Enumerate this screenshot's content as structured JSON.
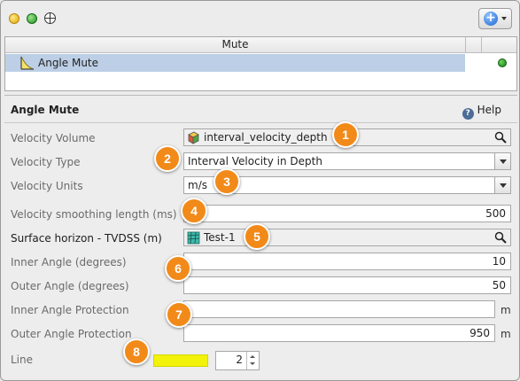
{
  "toolbar": {
    "window_controls": [
      "yellow",
      "green"
    ],
    "icons": [
      "grid-icon",
      "add-icon"
    ],
    "add_glyph": "+"
  },
  "table": {
    "header": "Mute",
    "rows": [
      {
        "label": "Angle Mute",
        "icon": "mute-icon",
        "status": "green"
      }
    ]
  },
  "panel": {
    "title": "Angle Mute",
    "help_label": "Help",
    "help_glyph": "?"
  },
  "form": {
    "velocity_volume": {
      "label": "Velocity Volume",
      "value": "interval_velocity_depth"
    },
    "velocity_type": {
      "label": "Velocity Type",
      "value": "Interval Velocity in Depth"
    },
    "velocity_units": {
      "label": "Velocity Units",
      "value": "m/s"
    },
    "smoothing": {
      "label": "Velocity smoothing length (ms)",
      "value": "500"
    },
    "surface_horizon": {
      "label": "Surface horizon - TVDSS (m)",
      "value": "Test-1"
    },
    "inner_angle": {
      "label": "Inner Angle (degrees)",
      "value": "10"
    },
    "outer_angle": {
      "label": "Outer Angle (degrees)",
      "value": "50"
    },
    "inner_protection": {
      "label": "Inner Angle Protection",
      "value": "",
      "unit": "m"
    },
    "outer_protection": {
      "label": "Outer Angle Protection",
      "value": "950",
      "unit": "m"
    },
    "line": {
      "label": "Line",
      "color": "#f2f20a",
      "width": "2"
    }
  },
  "callouts": [
    "1",
    "2",
    "3",
    "4",
    "5",
    "6",
    "7",
    "8"
  ],
  "colors": {
    "selection": "#bccfe6",
    "callout": "#f28a1a",
    "status_ok": "#2a9a2a"
  }
}
